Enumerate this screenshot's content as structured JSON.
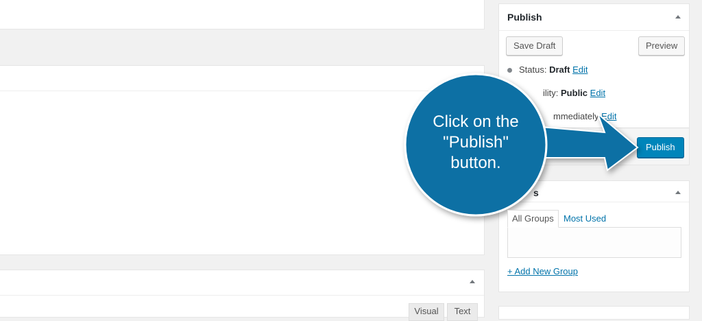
{
  "publish_box": {
    "title": "Publish",
    "save_draft": "Save Draft",
    "preview": "Preview",
    "status_label": "Status:",
    "status_value": "Draft",
    "visibility_label": "ility:",
    "visibility_value": "Public",
    "schedule_value": "mmediately",
    "edit": "Edit",
    "publish": "Publish"
  },
  "groups_box": {
    "title_fragment": "s",
    "tabs": [
      "All Groups",
      "Most Used"
    ],
    "add_new": "+ Add New Group"
  },
  "editor": {
    "tab_visual": "Visual",
    "tab_text": "Text"
  },
  "callout": {
    "text_line1": "Click on the",
    "text_line2": "\"Publish\"",
    "text_line3": "button."
  },
  "colors": {
    "callout": "#0b6fa4",
    "primary_button": "#0085ba",
    "link": "#0073aa"
  }
}
